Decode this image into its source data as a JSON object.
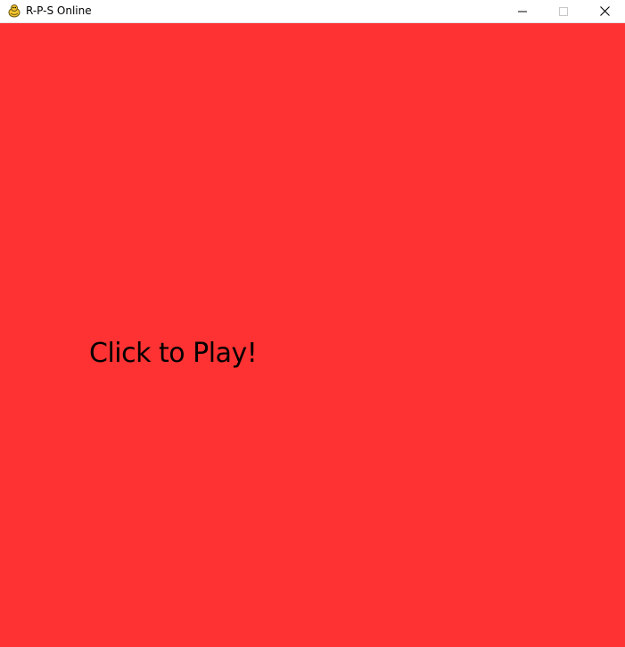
{
  "window": {
    "title": "R-P-S Online",
    "icon": "pygame-snake-icon",
    "controls": {
      "minimize_icon": "minimize-icon",
      "maximize_icon": "maximize-icon",
      "close_icon": "close-icon"
    }
  },
  "game": {
    "background_color": "#fe3232",
    "prompt": "Click to Play!"
  }
}
